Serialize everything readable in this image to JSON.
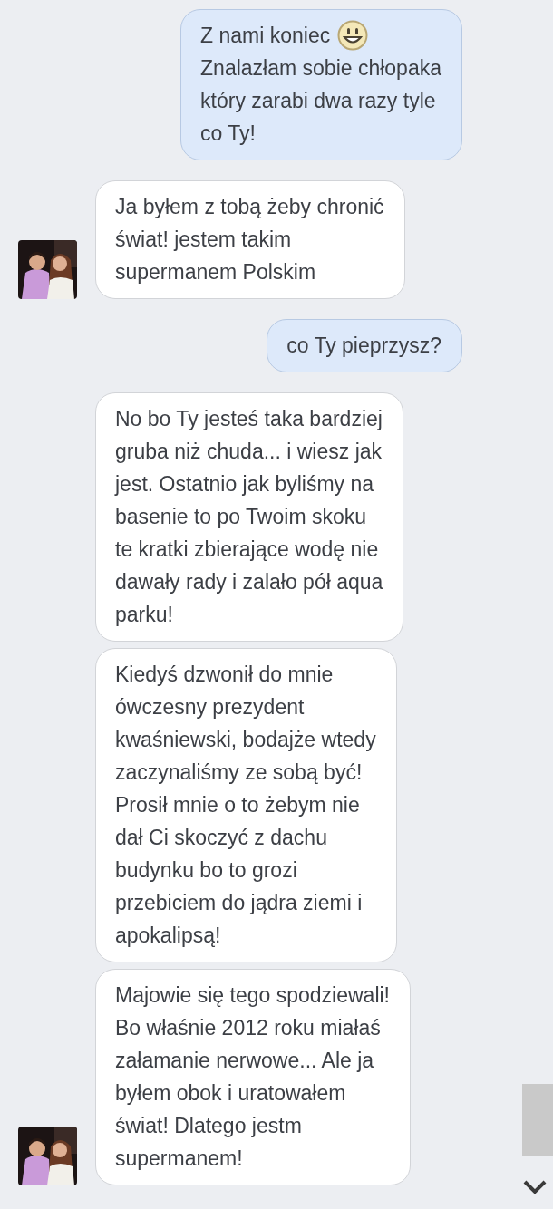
{
  "messages": [
    {
      "kind": "sent",
      "lead": "Z nami koniec",
      "emoji": true,
      "text": "Znalazłam sobie chłopaka\nktóry zarabi dwa razy tyle\nco Ty!",
      "avatar": false
    },
    {
      "kind": "received",
      "text": "Ja byłem z tobą żeby chronić\nświat! jestem takim\nsupermanem Polskim",
      "avatar": true
    },
    {
      "kind": "sent",
      "text": "co Ty pieprzysz?",
      "avatar": false
    },
    {
      "kind": "received",
      "text": "No bo Ty jesteś taka bardziej\ngruba niż chuda... i wiesz jak\njest. Ostatnio jak byliśmy na\nbasenie to po Twoim skoku\nte kratki zbierające wodę nie\ndawały rady i zalało pół aqua\nparku!",
      "avatar": false
    },
    {
      "kind": "received",
      "text": "Kiedyś dzwonił do mnie\nówczesny prezydent\nkwaśniewski, bodajże wtedy\nzaczynaliśmy ze sobą być!\nProsił mnie o to żebym nie\ndał Ci skoczyć z dachu\nbudynku bo to grozi\nprzebiciem do jądra ziemi i\napokalipsą!",
      "avatar": false
    },
    {
      "kind": "received",
      "text": "Majowie się tego spodziewali!\nBo właśnie 2012 roku miałaś\nzałamanie nerwowe... Ale ja\nbyłem obok i uratowałem\nświat! Dlatego jestm\nsupermanem!",
      "avatar": true
    }
  ]
}
